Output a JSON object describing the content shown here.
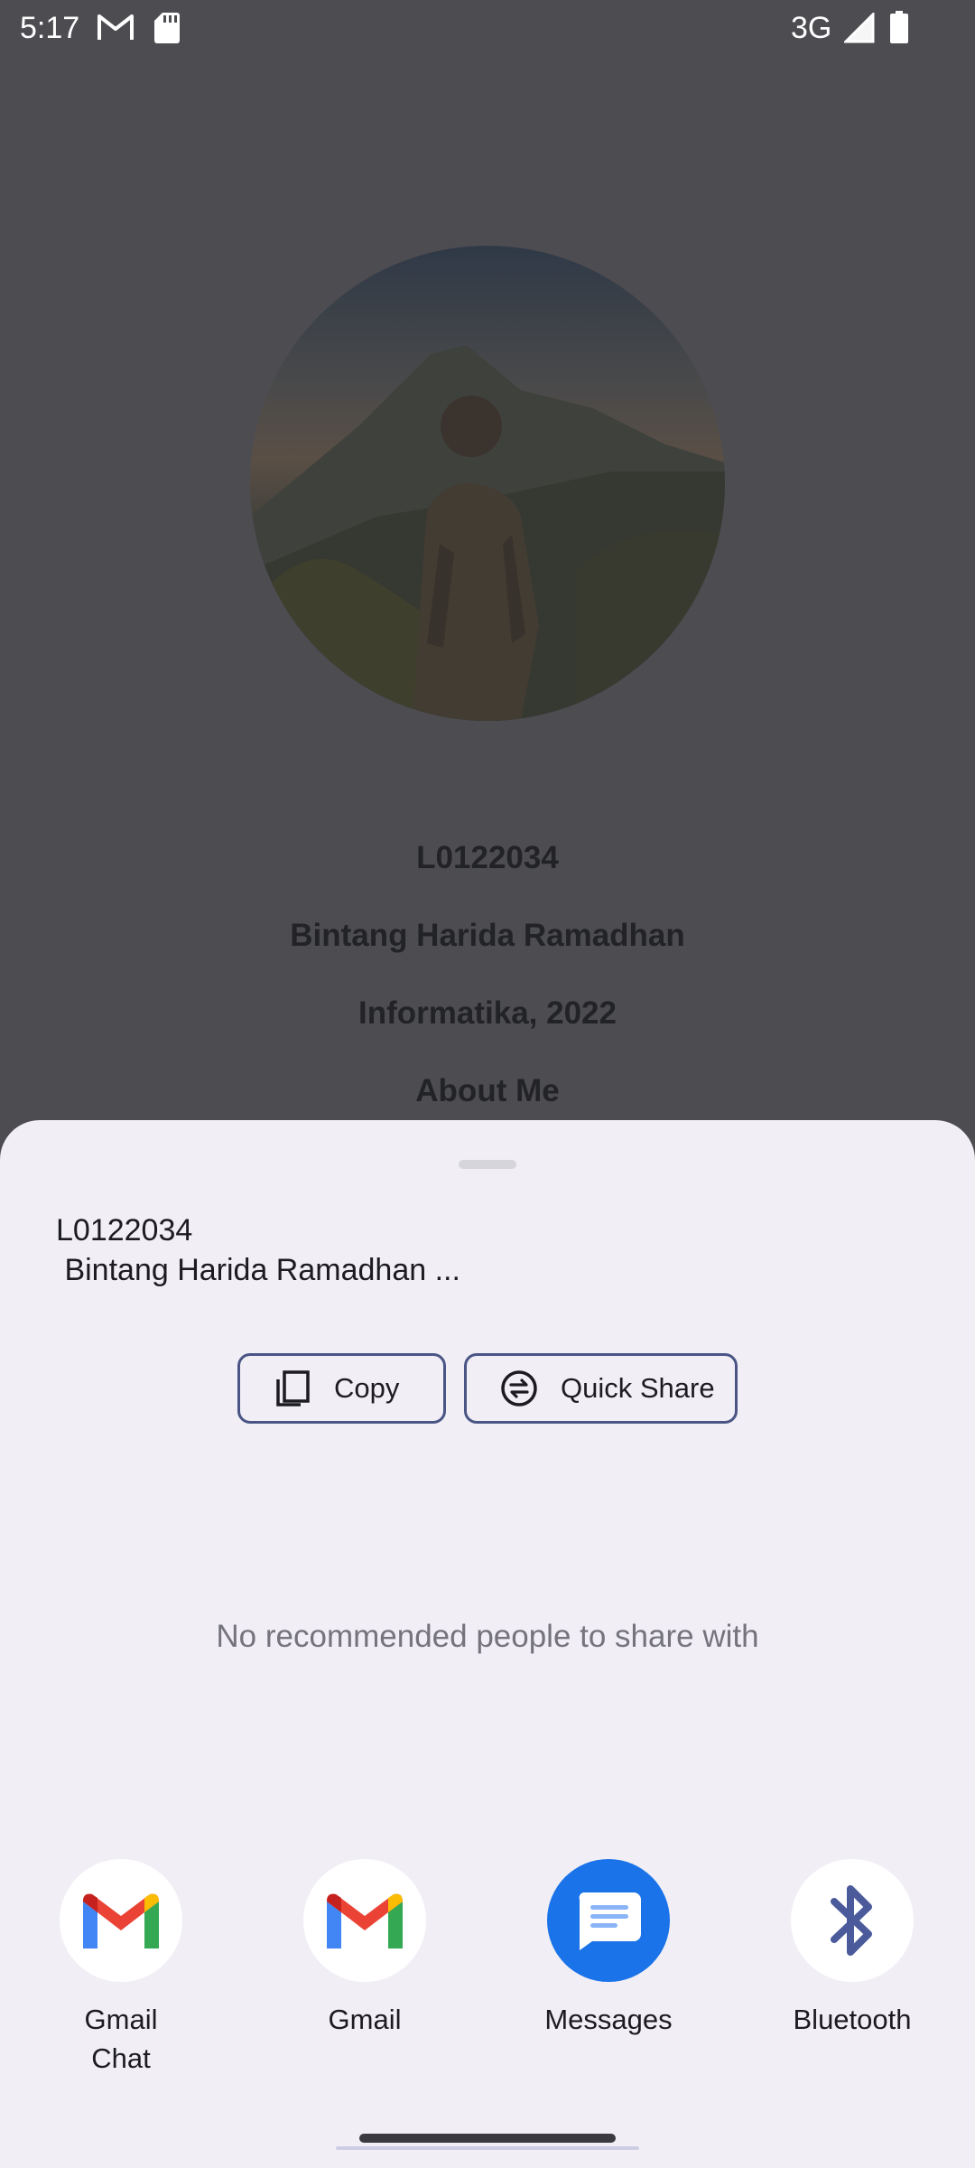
{
  "status_bar": {
    "time": "5:17",
    "network": "3G",
    "icons": [
      "gmail-icon",
      "sd-card-icon",
      "signal-icon",
      "battery-icon"
    ]
  },
  "profile": {
    "nim": "L0122034",
    "name": "Bintang Harida Ramadhan",
    "program": "Informatika, 2022",
    "about_heading": "About Me"
  },
  "share_sheet": {
    "preview_text": "L0122034\n Bintang Harida Ramadhan ...",
    "copy_label": "Copy",
    "quick_share_label": "Quick Share",
    "empty_message": "No recommended people to share with",
    "targets": [
      {
        "label": "Gmail\nChat",
        "icon": "gmail-icon"
      },
      {
        "label": "Gmail",
        "icon": "gmail-icon"
      },
      {
        "label": "Messages",
        "icon": "messages-icon"
      },
      {
        "label": "Bluetooth",
        "icon": "bluetooth-icon"
      }
    ]
  },
  "colors": {
    "scrim": "#4d4c51",
    "sheet_bg": "#f1eff5",
    "button_border": "#4a5585",
    "messages_blue": "#1a73e8",
    "bluetooth_blue": "#4a5a9a"
  }
}
